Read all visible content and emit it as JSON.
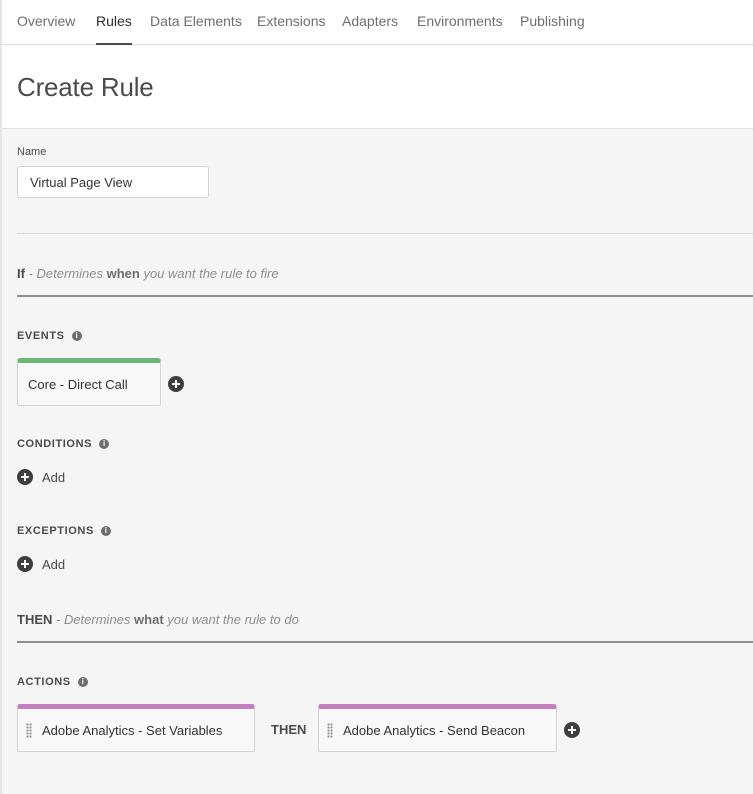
{
  "nav": {
    "tabs": [
      {
        "label": "Overview",
        "active": false
      },
      {
        "label": "Rules",
        "active": true
      },
      {
        "label": "Data Elements",
        "active": false
      },
      {
        "label": "Extensions",
        "active": false
      },
      {
        "label": "Adapters",
        "active": false
      },
      {
        "label": "Environments",
        "active": false
      },
      {
        "label": "Publishing",
        "active": false
      }
    ]
  },
  "header": {
    "title": "Create Rule"
  },
  "form": {
    "name_label": "Name",
    "name_value": "Virtual Page View"
  },
  "if_section": {
    "keyword": "If",
    "text_prefix": " - Determines ",
    "emphasis": "when",
    "text_suffix": " you want the rule to fire"
  },
  "events": {
    "label": "EVENTS",
    "items": [
      {
        "label": "Core - Direct Call"
      }
    ]
  },
  "conditions": {
    "label": "CONDITIONS",
    "add_label": "Add"
  },
  "exceptions": {
    "label": "EXCEPTIONS",
    "add_label": "Add"
  },
  "then_section": {
    "keyword": "THEN",
    "text_prefix": " - Determines ",
    "emphasis": "what",
    "text_suffix": " you want the rule to do"
  },
  "actions": {
    "label": "ACTIONS",
    "items": [
      {
        "label": "Adobe Analytics - Set Variables"
      },
      {
        "label": "Adobe Analytics - Send Beacon"
      }
    ],
    "separator": "THEN"
  },
  "icons": {
    "info": "info-icon",
    "add": "plus-circle-icon",
    "drag": "drag-handle-icon"
  },
  "colors": {
    "event_accent": "#6cb776",
    "action_accent": "#c17fbd"
  }
}
